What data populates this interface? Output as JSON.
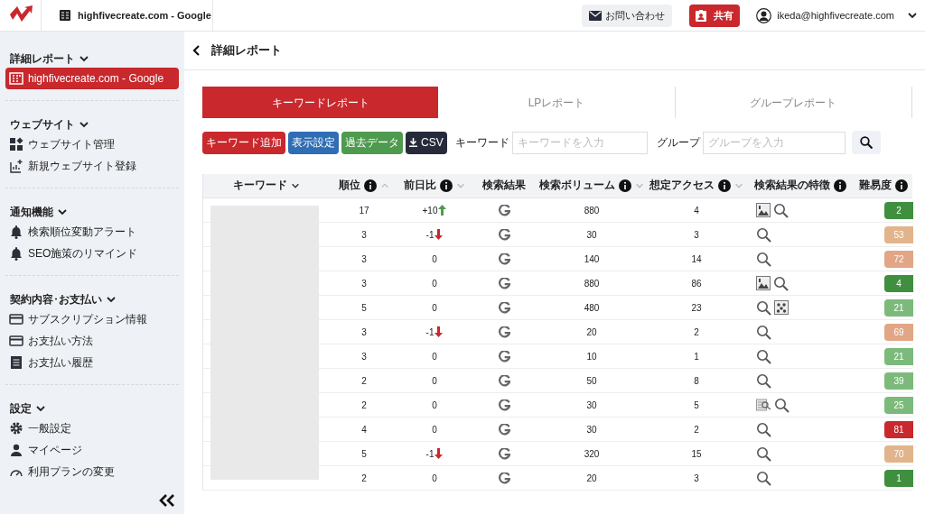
{
  "header": {
    "site": "highfivecreate.com - Google",
    "contact": "お問い合わせ",
    "share": "共有",
    "user": "ikeda@highfivecreate.com"
  },
  "sidebar": {
    "sections": [
      {
        "title": "詳細レポート",
        "expanded": true,
        "items": [
          {
            "label": "highfivecreate.com - Google",
            "kind": "building",
            "selected": true
          }
        ]
      },
      {
        "title": "ウェブサイト",
        "expanded": true,
        "items": [
          {
            "label": "ウェブサイト管理",
            "kind": "apps",
            "selected": false
          },
          {
            "label": "新規ウェブサイト登録",
            "kind": "chart",
            "selected": false
          }
        ]
      },
      {
        "title": "通知機能",
        "expanded": true,
        "items": [
          {
            "label": "検索順位変動アラート",
            "kind": "bell",
            "selected": false
          },
          {
            "label": "SEO施策のリマインド",
            "kind": "bell",
            "selected": false
          }
        ]
      },
      {
        "title": "契約内容･お支払い",
        "expanded": true,
        "items": [
          {
            "label": "サブスクリプション情報",
            "kind": "card",
            "selected": false
          },
          {
            "label": "お支払い方法",
            "kind": "card",
            "selected": false
          },
          {
            "label": "お支払い履歴",
            "kind": "list",
            "selected": false
          }
        ]
      },
      {
        "title": "設定",
        "expanded": true,
        "items": [
          {
            "label": "一般設定",
            "kind": "gear",
            "selected": false
          },
          {
            "label": "マイページ",
            "kind": "person",
            "selected": false
          },
          {
            "label": "利用プランの変更",
            "kind": "gauge",
            "selected": false
          }
        ]
      }
    ]
  },
  "page_title": "詳細レポート",
  "tabs": [
    {
      "label": "キーワードレポート",
      "selected": true
    },
    {
      "label": "LPレポート",
      "selected": false
    },
    {
      "label": "グループレポート",
      "selected": false
    }
  ],
  "toolbar": {
    "buttons": [
      {
        "label": "キーワード追加",
        "kind": "red"
      },
      {
        "label": "表示設定",
        "kind": "blue"
      },
      {
        "label": "過去データ",
        "kind": "green"
      },
      {
        "label": "CSV",
        "kind": "download"
      }
    ],
    "keyword_label": "キーワード",
    "keyword_placeholder": "キーワードを入力",
    "group_label": "グループ",
    "group_placeholder": "グループを入力"
  },
  "table": {
    "columns": [
      {
        "label": "キーワード",
        "info": false,
        "kind": "dropdown"
      },
      {
        "label": "順位",
        "info": true,
        "kind": "ascending"
      },
      {
        "label": "前日比",
        "info": true,
        "kind": "sortable"
      },
      {
        "label": "検索結果",
        "info": false,
        "kind": "plain"
      },
      {
        "label": "検索ボリューム",
        "info": true,
        "kind": "sortable"
      },
      {
        "label": "想定アクセス",
        "info": true,
        "kind": "sortable"
      },
      {
        "label": "検索結果の特徴",
        "info": true,
        "kind": "plain"
      },
      {
        "label": "難易度",
        "info": true,
        "kind": "plain"
      }
    ],
    "rows": [
      {
        "rank": "17",
        "change": "+10",
        "kind": "up",
        "volume": "880",
        "access": "4",
        "features": [
          {
            "kind": "image"
          },
          {
            "kind": "search"
          }
        ],
        "difficulty": "2",
        "color": "#3f8f3f"
      },
      {
        "rank": "3",
        "change": "-1",
        "kind": "down",
        "volume": "30",
        "access": "3",
        "features": [
          {
            "kind": "search"
          }
        ],
        "difficulty": "53",
        "color": "#e2b48c"
      },
      {
        "rank": "3",
        "change": "0",
        "kind": "flat",
        "volume": "140",
        "access": "14",
        "features": [
          {
            "kind": "search"
          }
        ],
        "difficulty": "72",
        "color": "#e0a686"
      },
      {
        "rank": "3",
        "change": "0",
        "kind": "flat",
        "volume": "880",
        "access": "86",
        "features": [
          {
            "kind": "image"
          },
          {
            "kind": "search"
          }
        ],
        "difficulty": "4",
        "color": "#3f8f3f"
      },
      {
        "rank": "5",
        "change": "0",
        "kind": "flat",
        "volume": "480",
        "access": "23",
        "features": [
          {
            "kind": "search"
          },
          {
            "kind": "map"
          }
        ],
        "difficulty": "21",
        "color": "#7cba7c"
      },
      {
        "rank": "3",
        "change": "-1",
        "kind": "down",
        "volume": "20",
        "access": "2",
        "features": [
          {
            "kind": "search"
          }
        ],
        "difficulty": "69",
        "color": "#e0a686"
      },
      {
        "rank": "3",
        "change": "0",
        "kind": "flat",
        "volume": "10",
        "access": "1",
        "features": [
          {
            "kind": "search"
          }
        ],
        "difficulty": "21",
        "color": "#7cba7c"
      },
      {
        "rank": "2",
        "change": "0",
        "kind": "flat",
        "volume": "50",
        "access": "8",
        "features": [
          {
            "kind": "search"
          }
        ],
        "difficulty": "39",
        "color": "#7cba7c"
      },
      {
        "rank": "2",
        "change": "0",
        "kind": "flat",
        "volume": "30",
        "access": "5",
        "features": [
          {
            "kind": "news"
          },
          {
            "kind": "search"
          }
        ],
        "difficulty": "25",
        "color": "#7cba7c"
      },
      {
        "rank": "4",
        "change": "0",
        "kind": "flat",
        "volume": "30",
        "access": "2",
        "features": [
          {
            "kind": "search"
          }
        ],
        "difficulty": "81",
        "color": "#c9282d"
      },
      {
        "rank": "5",
        "change": "-1",
        "kind": "down",
        "volume": "320",
        "access": "15",
        "features": [
          {
            "kind": "search"
          }
        ],
        "difficulty": "70",
        "color": "#e2b48c"
      },
      {
        "rank": "2",
        "change": "0",
        "kind": "flat",
        "volume": "20",
        "access": "3",
        "features": [
          {
            "kind": "search"
          }
        ],
        "difficulty": "1",
        "color": "#3f8f3f"
      }
    ]
  }
}
